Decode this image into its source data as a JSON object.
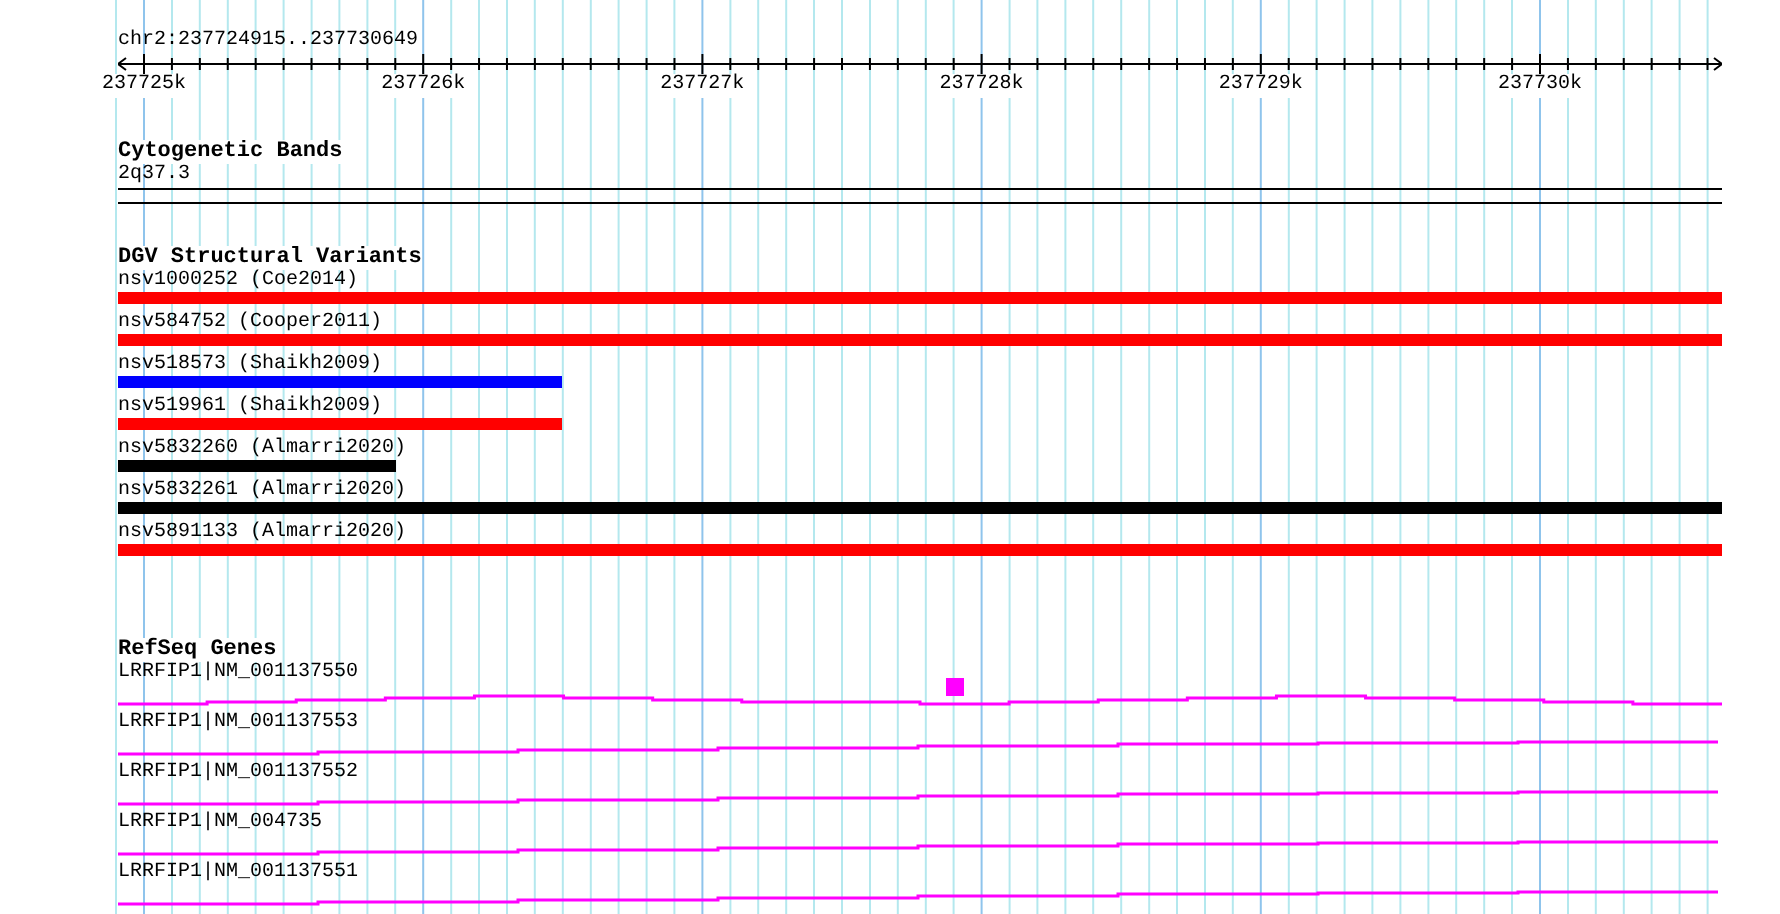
{
  "ruler": {
    "range": "chr2:237724915..237730649",
    "ticks": [
      "237725k",
      "237726k",
      "237727k",
      "237728k",
      "237729k",
      "237730k"
    ]
  },
  "cytoband_track": {
    "title": "Cytogenetic Bands",
    "band": "2q37.3"
  },
  "variant_track": {
    "title": "DGV Structural Variants",
    "variants": [
      {
        "label": "nsv1000252 (Coe2014)",
        "color": "#ff0000",
        "level": 1
      },
      {
        "label": "nsv584752 (Cooper2011)",
        "color": "#ff0000",
        "level": 1
      },
      {
        "label": "nsv518573 (Shaikh2009)",
        "color": "#0000ff",
        "level": 0.277
      },
      {
        "label": "nsv519961 (Shaikh2009)",
        "color": "#ff0000",
        "level": 0.277
      },
      {
        "label": "nsv5832260 (Almarri2020)",
        "color": "#000000",
        "level": 0.173
      },
      {
        "label": "nsv5832261 (Almarri2020)",
        "color": "#000000",
        "level": 1
      },
      {
        "label": "nsv5891133 (Almarri2020)",
        "color": "#ff0000",
        "level": 1
      }
    ]
  },
  "gene_track": {
    "title": "RefSeq Genes",
    "genes": [
      {
        "label": "LRRFIP1|NM_001137550",
        "marker": true
      },
      {
        "label": "LRRFIP1|NM_001137553",
        "marker": false
      },
      {
        "label": "LRRFIP1|NM_001137552",
        "marker": false
      },
      {
        "label": "LRRFIP1|NM_004735",
        "marker": false
      },
      {
        "label": "LRRFIP1|NM_001137551",
        "marker": false
      }
    ]
  }
}
